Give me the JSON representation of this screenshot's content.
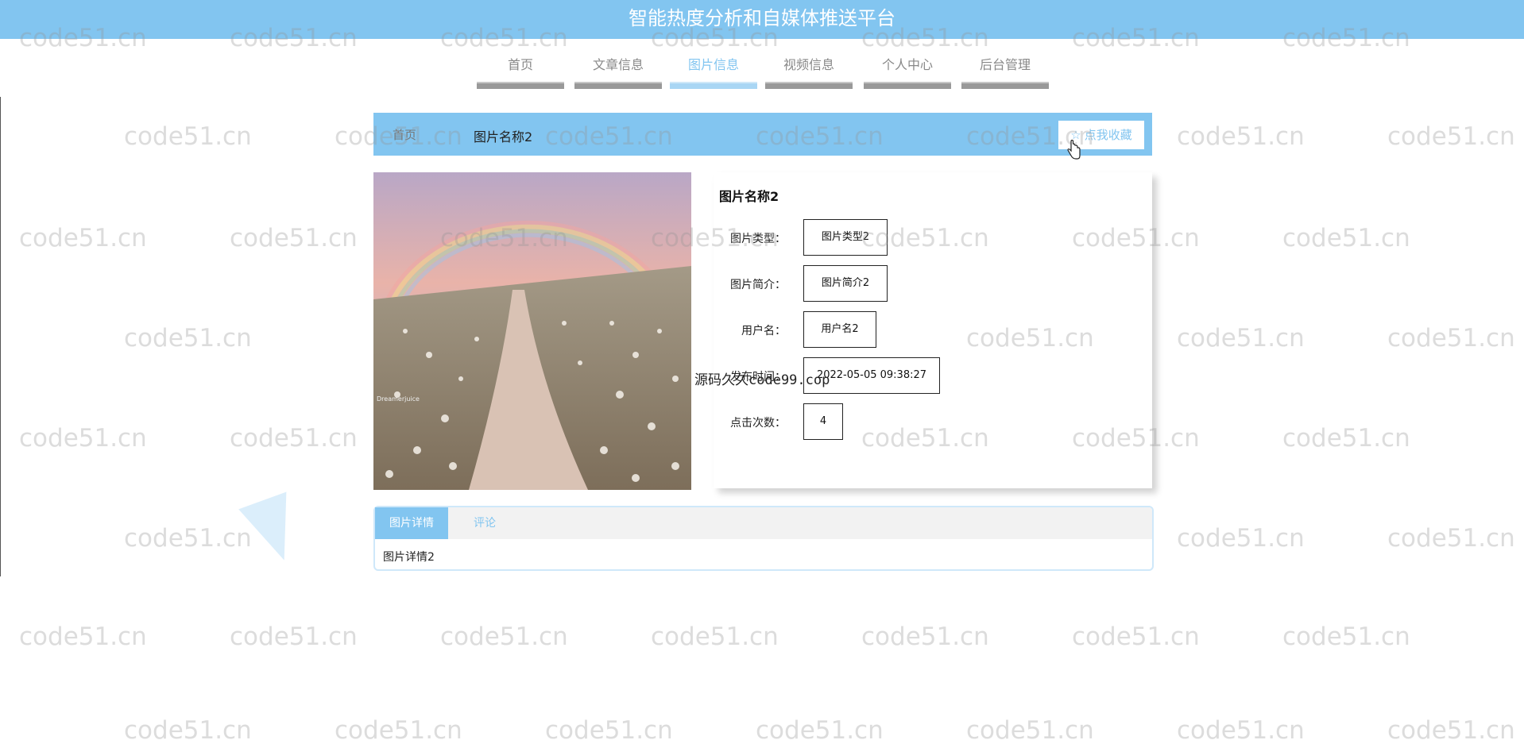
{
  "header": {
    "title": "智能热度分析和自媒体推送平台"
  },
  "nav": {
    "items": [
      {
        "label": "首页",
        "active": false
      },
      {
        "label": "文章信息",
        "active": false
      },
      {
        "label": "图片信息",
        "active": true
      },
      {
        "label": "视频信息",
        "active": false
      },
      {
        "label": "个人中心",
        "active": false
      },
      {
        "label": "后台管理",
        "active": false
      }
    ]
  },
  "detail_header": {
    "breadcrumb_home": "首页",
    "title": "图片名称2",
    "favorite_label": "点我收藏",
    "favorite_icon": "star-icon"
  },
  "photo": {
    "caption": "Dreamerjuice"
  },
  "info": {
    "title": "图片名称2",
    "fields": [
      {
        "label": "图片类型：",
        "value": "图片类型2"
      },
      {
        "label": "图片简介：",
        "value": "图片简介2"
      },
      {
        "label": "用户名：",
        "value": "用户名2"
      },
      {
        "label": "发布时间：",
        "value": "2022-05-05 09:38:27"
      },
      {
        "label": "点击次数：",
        "value": "4"
      }
    ]
  },
  "tabs": {
    "items": [
      {
        "label": "图片详情",
        "active": true
      },
      {
        "label": "评论",
        "active": false
      }
    ],
    "content": "图片详情2"
  },
  "overlay": {
    "text_cn": "源码久久",
    "text_site": "code99.cop"
  },
  "watermark": {
    "text": "code51.cn"
  },
  "colors": {
    "primary": "#82c5f0",
    "nav_bar": "#999999"
  }
}
